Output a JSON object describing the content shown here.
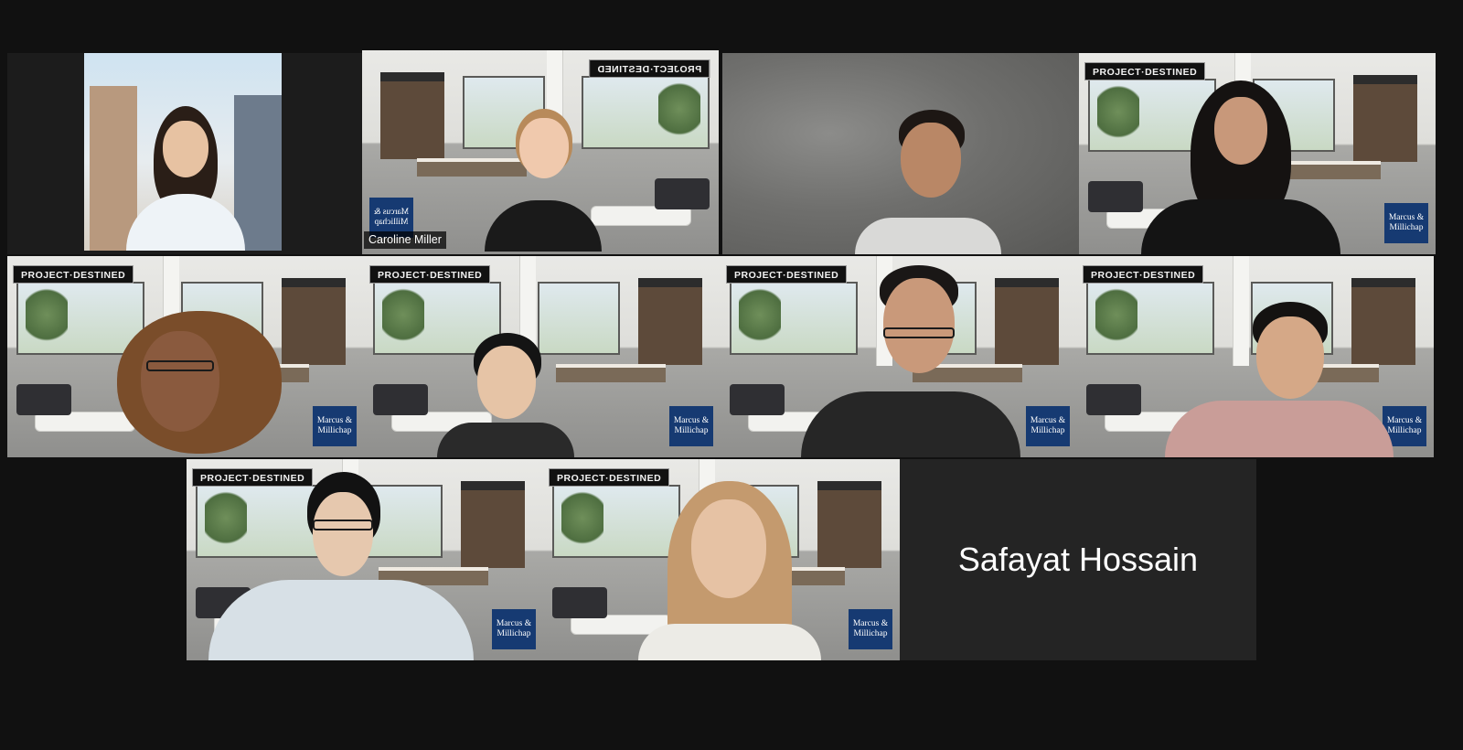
{
  "brand": {
    "project_destined": "PROJECT·DESTINED",
    "marcus_millichap": "Marcus & Millichap"
  },
  "colors": {
    "background": "#111111",
    "active_speaker_border": "#d6f07a",
    "empty_tile": "#242424",
    "mm_badge": "#163a72"
  },
  "participants": [
    {
      "id": "p1",
      "name": "",
      "video": true,
      "background": "city"
    },
    {
      "id": "p2",
      "name": "Caroline Miller",
      "video": true,
      "background": "office-mirrored",
      "active_speaker": true
    },
    {
      "id": "p3",
      "name": "",
      "video": true,
      "background": "blurred"
    },
    {
      "id": "p4",
      "name": "",
      "video": true,
      "background": "office"
    },
    {
      "id": "p5",
      "name": "",
      "video": true,
      "background": "office"
    },
    {
      "id": "p6",
      "name": "",
      "video": true,
      "background": "office"
    },
    {
      "id": "p7",
      "name": "",
      "video": true,
      "background": "office"
    },
    {
      "id": "p8",
      "name": "",
      "video": true,
      "background": "office"
    },
    {
      "id": "p9",
      "name": "",
      "video": true,
      "background": "office"
    },
    {
      "id": "p10",
      "name": "",
      "video": true,
      "background": "office"
    },
    {
      "id": "p11",
      "name": "Safayat Hossain",
      "video": false
    }
  ]
}
